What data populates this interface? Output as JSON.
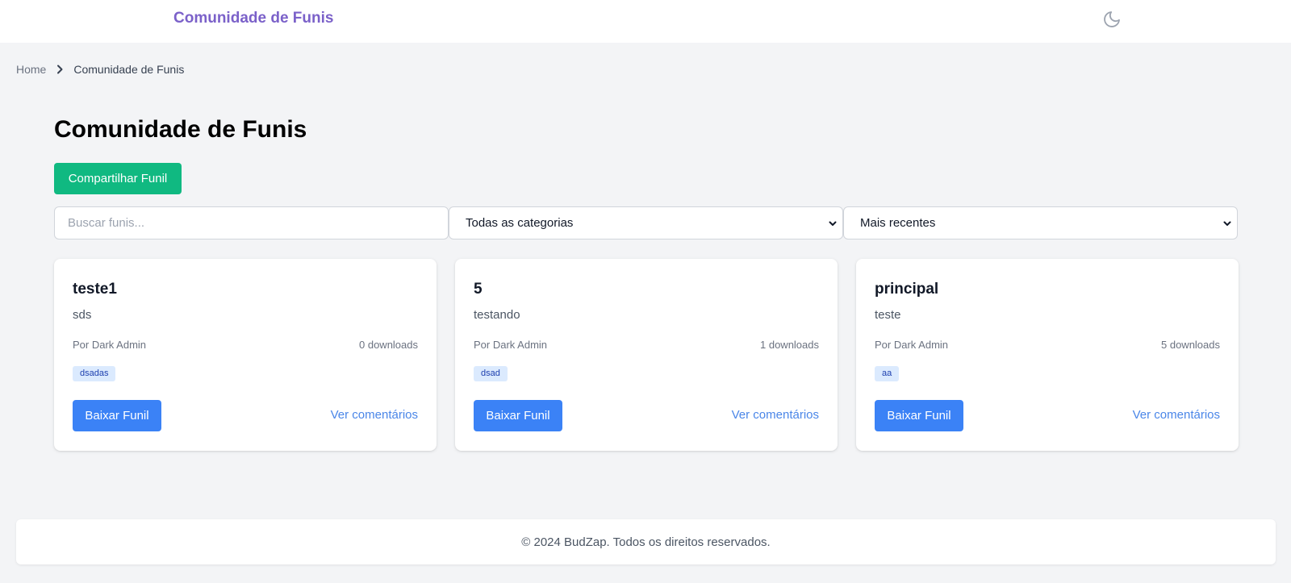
{
  "header": {
    "brand": "Comunidade de Funis",
    "theme_toggle_icon": "moon-icon"
  },
  "breadcrumb": {
    "home": "Home",
    "separator_icon": "chevron-right-icon",
    "current": "Comunidade de Funis"
  },
  "page": {
    "title": "Comunidade de Funis",
    "share_button": "Compartilhar Funil"
  },
  "filters": {
    "search_placeholder": "Buscar funis...",
    "search_value": "",
    "category_selected": "Todas as categorias",
    "sort_selected": "Mais recentes"
  },
  "cards": [
    {
      "title": "teste1",
      "description": "sds",
      "author": "Por Dark Admin",
      "downloads": "0 downloads",
      "tag": "dsadas",
      "download_label": "Baixar Funil",
      "comments_label": "Ver comentários"
    },
    {
      "title": "5",
      "description": "testando",
      "author": "Por Dark Admin",
      "downloads": "1 downloads",
      "tag": "dsad",
      "download_label": "Baixar Funil",
      "comments_label": "Ver comentários"
    },
    {
      "title": "principal",
      "description": "teste",
      "author": "Por Dark Admin",
      "downloads": "5 downloads",
      "tag": "aa",
      "download_label": "Baixar Funil",
      "comments_label": "Ver comentários"
    }
  ],
  "footer": {
    "text": "© 2024 BudZap. Todos os direitos reservados."
  },
  "colors": {
    "brand": "#7b61c9",
    "share_button": "#10b981",
    "primary_button": "#3b82f6",
    "link": "#4a86e8",
    "tag_bg": "#dbeafe",
    "tag_text": "#1e40af",
    "background": "#f3f4f6"
  }
}
